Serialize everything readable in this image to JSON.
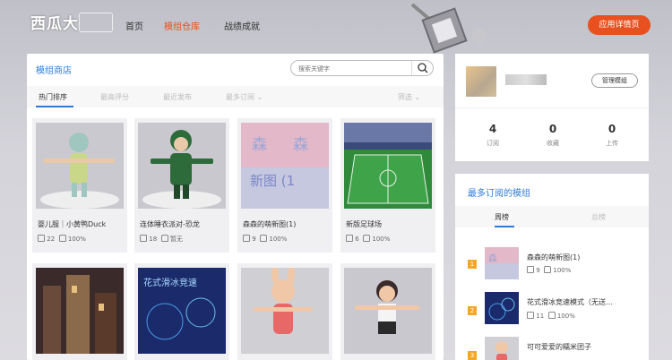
{
  "header": {
    "logo_text": "西瓜大",
    "nav": [
      "首页",
      "模组仓库",
      "战绩成就"
    ],
    "cta_label": "应用详情页"
  },
  "mod_store": {
    "title": "模组商店",
    "search_placeholder": "搜索关键字",
    "tabs": [
      "热门排序",
      "最高评分",
      "最近发布",
      "最多订阅"
    ],
    "filter_label": "筛选",
    "cards": [
      {
        "title": "婴儿服｜小黄鸭Duck",
        "subs": "22",
        "rating": "100%"
      },
      {
        "title": "连体睡衣派对-恐龙",
        "subs": "18",
        "rating": "暂无"
      },
      {
        "title": "森森的萌新图(1)",
        "subs": "9",
        "rating": "100%"
      },
      {
        "title": "新版足球场",
        "subs": "6",
        "rating": "100%"
      }
    ],
    "thumb_text_3": "森 森 新图 (1",
    "thumb_text_6": "花式滑冰竞速"
  },
  "profile": {
    "manage_label": "管理模组",
    "stats": [
      {
        "value": "4",
        "label": "订阅"
      },
      {
        "value": "0",
        "label": "收藏"
      },
      {
        "value": "0",
        "label": "上传"
      }
    ]
  },
  "popular": {
    "title": "最多订阅的模组",
    "tabs": [
      "周榜",
      "总榜"
    ],
    "items": [
      {
        "rank": "1",
        "name": "森森的萌新图(1)",
        "subs": "9",
        "rating": "100%"
      },
      {
        "rank": "2",
        "name": "花式滑冰竞速模式（无送…",
        "subs": "11",
        "rating": "100%"
      },
      {
        "rank": "3",
        "name": "可可爱爱的糯米团子",
        "subs": "",
        "rating": ""
      }
    ]
  }
}
